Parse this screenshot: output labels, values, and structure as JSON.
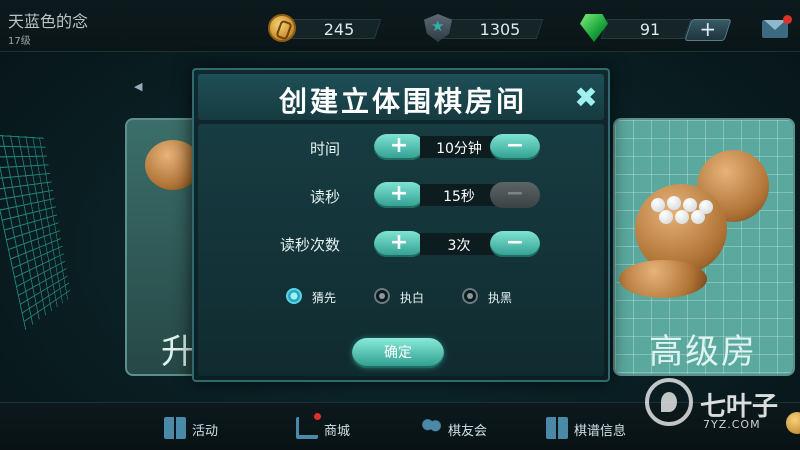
{
  "player": {
    "name": "天蓝色的念",
    "level": "17级"
  },
  "resources": {
    "coins": "245",
    "score": "1305",
    "gems": "91",
    "add_label": "+"
  },
  "cards": {
    "left_label": "升",
    "right_label": "高级房"
  },
  "dialog": {
    "title": "创建立体围棋房间",
    "close_symbol": "✖",
    "rows": [
      {
        "label": "时间",
        "value": "10分钟",
        "plus": "+",
        "minus": "−"
      },
      {
        "label": "读秒",
        "value": "15秒",
        "plus": "+",
        "minus": "−"
      },
      {
        "label": "读秒次数",
        "value": "3次",
        "plus": "+",
        "minus": "−"
      }
    ],
    "color_options": [
      {
        "label": "猜先",
        "selected": true
      },
      {
        "label": "执白",
        "selected": false
      },
      {
        "label": "执黑",
        "selected": false
      }
    ],
    "confirm_label": "确定"
  },
  "nav": [
    {
      "label": "活动",
      "icon": "gift-icon"
    },
    {
      "label": "商城",
      "icon": "cart-icon"
    },
    {
      "label": "棋友会",
      "icon": "friends-icon"
    },
    {
      "label": "棋谱信息",
      "icon": "book-icon"
    }
  ],
  "watermark": {
    "text": "七叶子",
    "sub": "7YZ.COM"
  },
  "colors": {
    "accent": "#2f9d8f",
    "panel": "#102b30",
    "title_bar": "#1f4f57"
  }
}
